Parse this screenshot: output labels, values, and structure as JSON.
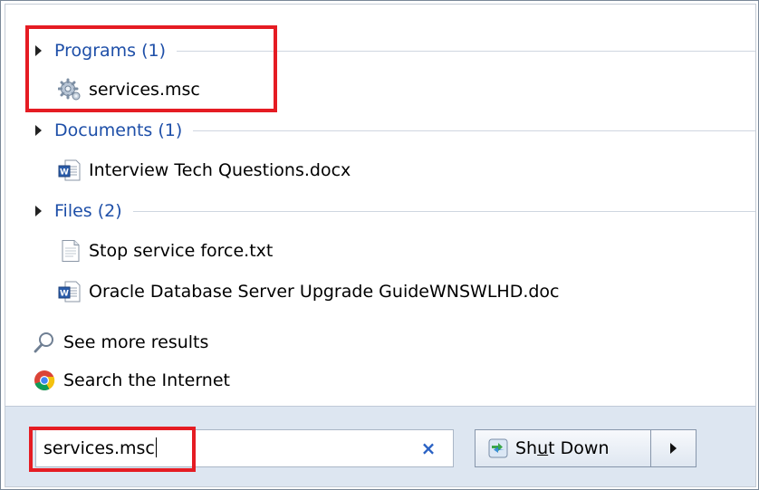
{
  "groups": [
    {
      "label": "Programs (1)",
      "items": [
        {
          "label": "services.msc",
          "icon": "services-gear-icon"
        }
      ]
    },
    {
      "label": "Documents (1)",
      "items": [
        {
          "label": "Interview Tech Questions.docx",
          "icon": "word-document-icon"
        }
      ]
    },
    {
      "label": "Files (2)",
      "items": [
        {
          "label": "Stop service force.txt",
          "icon": "text-file-icon"
        },
        {
          "label": "Oracle Database Server Upgrade GuideWNSWLHD.doc",
          "icon": "word-document-icon"
        }
      ]
    }
  ],
  "links": {
    "see_more": "See more results",
    "search_internet": "Search the Internet"
  },
  "search": {
    "value": "services.msc",
    "clear_label": "×"
  },
  "shutdown": {
    "label_pre": "Sh",
    "label_underlined": "u",
    "label_post": "t Down"
  },
  "colors": {
    "group_header": "#1e4fa8",
    "annotation": "#e51c23",
    "bottom_panel": "#dde6f1"
  }
}
